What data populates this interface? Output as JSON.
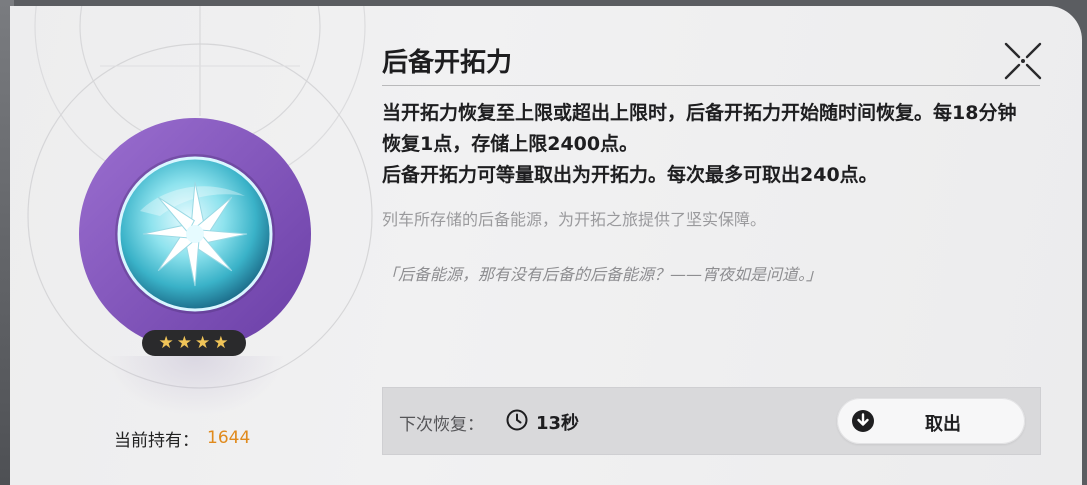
{
  "dialog": {
    "title": "后备开拓力",
    "description": [
      "当开拓力恢复至上限或超出上限时，后备开拓力开始随时间恢复。每18分钟恢复1点，存储上限2400点。",
      "后备开拓力可等量取出为开拓力。每次最多可取出240点。"
    ],
    "flavor_text": "列车所存储的后备能源，为开拓之旅提供了坚实保障。",
    "quote": "「后备能源，那有没有后备的后备能源？——宵夜如是问道。」"
  },
  "item": {
    "stars": [
      "★",
      "★",
      "★",
      "★"
    ],
    "rarity_color": "#f0c458",
    "owned_label": "当前持有：",
    "owned_value": "1644",
    "owned_value_color": "#e08a1c",
    "icon": "reserved-trailblaze-power-orb-icon"
  },
  "footer": {
    "next_recovery_label": "下次恢复：",
    "next_recovery_value": "13秒",
    "take_out_label": "取出",
    "clock_icon": "clock-icon",
    "take_out_icon": "download-arrow-icon"
  },
  "colors": {
    "accent_orange": "#e08a1c",
    "orb_ring": "#8b5fbf"
  }
}
